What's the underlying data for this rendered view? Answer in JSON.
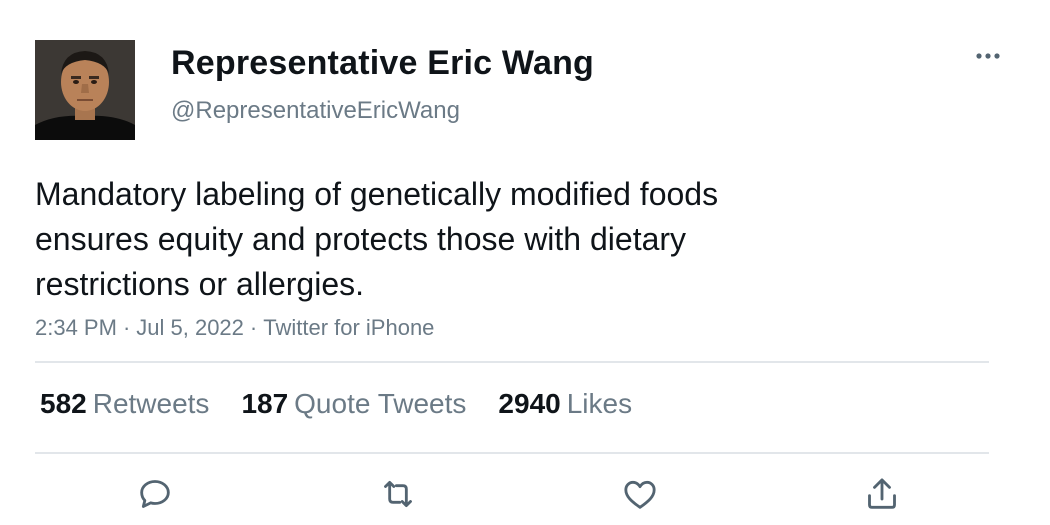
{
  "author": {
    "display_name": "Representative Eric Wang",
    "handle": "@RepresentativeEricWang",
    "avatar": "profile-photo"
  },
  "tweet": {
    "lines": [
      "Mandatory labeling of genetically modified foods",
      "ensures equity and protects those with dietary",
      "restrictions or allergies."
    ],
    "time": "2:34 PM",
    "separator": "·",
    "date": "Jul 5, 2022",
    "source": "Twitter for iPhone"
  },
  "stats": {
    "retweets": {
      "count": "582",
      "label": "Retweets"
    },
    "quote_tweets": {
      "count": "187",
      "label": "Quote Tweets"
    },
    "likes": {
      "count": "2940",
      "label": "Likes"
    }
  },
  "actions": {
    "icons": [
      "reply-icon",
      "retweet-icon",
      "like-icon",
      "share-icon"
    ]
  },
  "colors": {
    "text": "#0f1419",
    "secondary_text": "#6b7a86",
    "divider": "#e2e6ea",
    "icon": "#536471"
  }
}
